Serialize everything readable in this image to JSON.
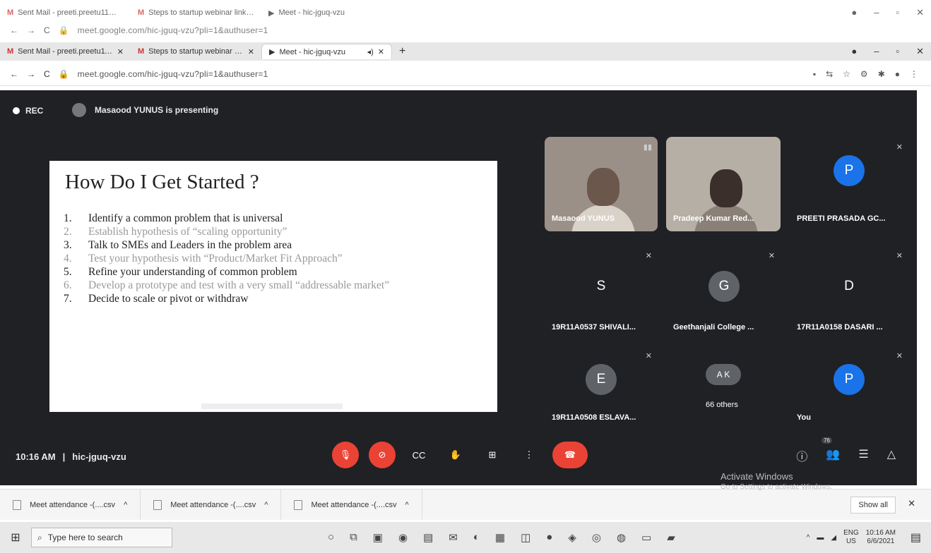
{
  "browser_back": {
    "tabs": [
      {
        "icon": "M",
        "label": "Sent Mail - preeti.preetu11@gm",
        "active": false
      },
      {
        "icon": "M",
        "label": "Steps to startup webinar link - p",
        "active": false
      },
      {
        "icon": "▶",
        "label": "Meet - hic-jguq-vzu",
        "active": true
      }
    ],
    "url": "meet.google.com/hic-jguq-vzu?pli=1&authuser=1"
  },
  "browser": {
    "tabs": [
      {
        "icon": "M",
        "label": "Sent Mail - preeti.preetu11@gm",
        "active": false
      },
      {
        "icon": "M",
        "label": "Steps to startup webinar link - p",
        "active": false
      },
      {
        "icon": "▶",
        "label": "Meet - hic-jguq-vzu",
        "active": true
      }
    ],
    "new_tab": "+",
    "url": "meet.google.com/hic-jguq-vzu?pli=1&authuser=1"
  },
  "meet": {
    "rec_label": "REC",
    "presenting_text": "Masaood YUNUS is presenting",
    "slide": {
      "title": "How Do I Get Started ?",
      "items": [
        {
          "n": "1.",
          "text": "Identify a common problem that is universal",
          "light": false
        },
        {
          "n": "2.",
          "text": "Establish hypothesis of  “scaling opportunity”",
          "light": true
        },
        {
          "n": "3.",
          "text": "Talk to SMEs and Leaders in the problem area",
          "light": false
        },
        {
          "n": "4.",
          "text": "Test your hypothesis with  “Product/Market Fit Approach”",
          "light": true
        },
        {
          "n": "5.",
          "text": "Refine your understanding of common problem",
          "light": false
        },
        {
          "n": "6.",
          "text": "Develop a prototype and test with a very small  “addressable market”",
          "light": true
        },
        {
          "n": "7.",
          "text": "Decide to scale or pivot or withdraw",
          "light": false
        }
      ]
    },
    "tiles": [
      {
        "name": "Masaood YUNUS",
        "letter": "",
        "color": ""
      },
      {
        "name": "Pradeep Kumar Red...",
        "letter": "",
        "color": ""
      },
      {
        "name": "PREETI PRASADA GC...",
        "letter": "P",
        "color": "#1a73e8"
      },
      {
        "name": "19R11A0537 SHIVALI...",
        "letter": "S",
        "color": "#5f6368"
      },
      {
        "name": "Geethanjali College ...",
        "letter": "G",
        "color": "#5f6368"
      },
      {
        "name": "17R11A0158 DASARI ...",
        "letter": "D",
        "color": "#5f6368"
      },
      {
        "name": "19R11A0508 ESLAVA...",
        "letter": "E",
        "color": "#5f6368"
      },
      {
        "name": "66 others",
        "letter": "A K",
        "color": "#5f6368"
      },
      {
        "name": "You",
        "letter": "P",
        "color": "#1a73e8"
      }
    ],
    "time": "10:16 AM",
    "meeting_code": "hic-jguq-vzu",
    "people_count": "76"
  },
  "downloads": {
    "items": [
      "Meet attendance -(....csv",
      "Meet attendance -(....csv",
      "Meet attendance -(....csv"
    ],
    "show_all": "Show all",
    "activate_title": "Activate Windows",
    "activate_sub": "Go to Settings to activate Windows."
  },
  "taskbar": {
    "search_placeholder": "Type here to search",
    "lang": "ENG",
    "region": "US",
    "time": "10:16 AM",
    "date": "6/6/2021"
  }
}
